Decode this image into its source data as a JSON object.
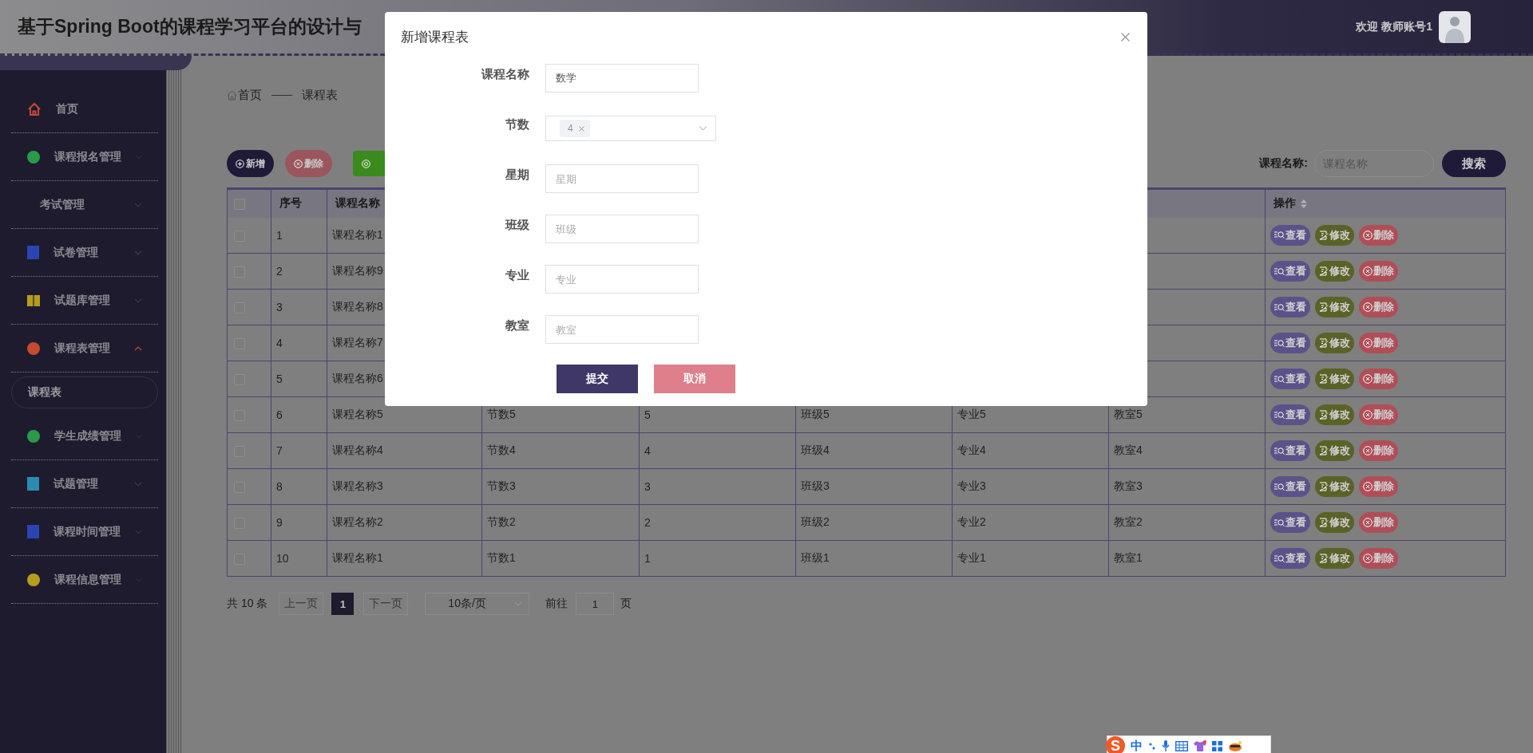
{
  "header": {
    "title": "基于Spring Boot的课程学习平台的设计与",
    "welcome": "欢迎 教师账号1"
  },
  "sidebar": {
    "items": [
      {
        "label": "首页",
        "color": "#c44a30"
      },
      {
        "label": "课程报名管理",
        "color": "#2a9a4a",
        "expanded": false
      },
      {
        "label": "考试管理",
        "expanded": false
      },
      {
        "label": "试卷管理",
        "color": "#2a44b4",
        "expanded": false
      },
      {
        "label": "试题库管理",
        "color": "#b89c1c",
        "expanded": false
      },
      {
        "label": "课程表管理",
        "color": "#c44a30",
        "expanded": true,
        "children": [
          {
            "label": "课程表",
            "selected": true
          }
        ]
      },
      {
        "label": "学生成绩管理",
        "color": "#2a9a4a",
        "expanded": false
      },
      {
        "label": "试题管理",
        "color": "#2a8cb0",
        "expanded": false
      },
      {
        "label": "课程时间管理",
        "color": "#2a44b4",
        "expanded": false
      },
      {
        "label": "课程信息管理",
        "color": "#b89c1c",
        "expanded": false
      }
    ]
  },
  "breadcrumb": [
    "首页",
    "课程表"
  ],
  "toolbar": {
    "buttons": [
      {
        "kind": "add",
        "label": "新增"
      },
      {
        "kind": "delete",
        "label": "删除"
      },
      {
        "kind": "other"
      }
    ],
    "search": {
      "label": "课程名称:",
      "placeholder": "课程名称",
      "button": "搜索"
    }
  },
  "table": {
    "select_all_checked": false,
    "columns": [
      {
        "label": "序号"
      },
      {
        "label": "课程名称"
      },
      {},
      {},
      {},
      {},
      {},
      {
        "label": "操作",
        "sortable": true
      }
    ],
    "rows": [
      {
        "checked": false,
        "cells": [
          "1",
          "课程名称1"
        ],
        "actions": [
          {
            "kind": "view",
            "label": "查看"
          },
          {
            "kind": "edit",
            "label": "修改"
          },
          {
            "kind": "delete",
            "label": "删除"
          }
        ]
      },
      {
        "checked": false,
        "cells": [
          "2",
          "课程名称9"
        ],
        "actions": [
          {
            "kind": "view",
            "label": "查看"
          },
          {
            "kind": "edit",
            "label": "修改"
          },
          {
            "kind": "delete",
            "label": "删除"
          }
        ]
      },
      {
        "checked": false,
        "cells": [
          "3",
          "课程名称8"
        ],
        "actions": [
          {
            "kind": "view",
            "label": "查看"
          },
          {
            "kind": "edit",
            "label": "修改"
          },
          {
            "kind": "delete",
            "label": "删除"
          }
        ]
      },
      {
        "checked": false,
        "cells": [
          "4",
          "课程名称7"
        ],
        "actions": [
          {
            "kind": "view",
            "label": "查看"
          },
          {
            "kind": "edit",
            "label": "修改"
          },
          {
            "kind": "delete",
            "label": "删除"
          }
        ]
      },
      {
        "checked": false,
        "cells": [
          "5",
          "课程名称6"
        ],
        "actions": [
          {
            "kind": "view",
            "label": "查看"
          },
          {
            "kind": "edit",
            "label": "修改"
          },
          {
            "kind": "delete",
            "label": "删除"
          }
        ]
      },
      {
        "checked": false,
        "cells": [
          "6",
          "课程名称5",
          "节数5",
          "5",
          "班级5",
          "专业5",
          "教室5"
        ],
        "actions": [
          {
            "kind": "view",
            "label": "查看"
          },
          {
            "kind": "edit",
            "label": "修改"
          },
          {
            "kind": "delete",
            "label": "删除"
          }
        ]
      },
      {
        "checked": false,
        "cells": [
          "7",
          "课程名称4",
          "节数4",
          "4",
          "班级4",
          "专业4",
          "教室4"
        ],
        "actions": [
          {
            "kind": "view",
            "label": "查看"
          },
          {
            "kind": "edit",
            "label": "修改"
          },
          {
            "kind": "delete",
            "label": "删除"
          }
        ]
      },
      {
        "checked": false,
        "cells": [
          "8",
          "课程名称3",
          "节数3",
          "3",
          "班级3",
          "专业3",
          "教室3"
        ],
        "actions": [
          {
            "kind": "view",
            "label": "查看"
          },
          {
            "kind": "edit",
            "label": "修改"
          },
          {
            "kind": "delete",
            "label": "删除"
          }
        ]
      },
      {
        "checked": false,
        "cells": [
          "9",
          "课程名称2",
          "节数2",
          "2",
          "班级2",
          "专业2",
          "教室2"
        ],
        "actions": [
          {
            "kind": "view",
            "label": "查看"
          },
          {
            "kind": "edit",
            "label": "修改"
          },
          {
            "kind": "delete",
            "label": "删除"
          }
        ]
      },
      {
        "checked": false,
        "cells": [
          "10",
          "课程名称1",
          "节数1",
          "1",
          "班级1",
          "专业1",
          "教室1"
        ],
        "actions": [
          {
            "kind": "view",
            "label": "查看"
          },
          {
            "kind": "edit",
            "label": "修改"
          },
          {
            "kind": "delete",
            "label": "删除"
          }
        ]
      }
    ]
  },
  "pagination": {
    "total": "共 10 条",
    "prev": {
      "label": "上一页",
      "disabled": true
    },
    "pages": [
      {
        "label": "1",
        "selected": true
      }
    ],
    "next": {
      "label": "下一页",
      "disabled": true
    },
    "page_size": "10条/页",
    "goto_label": "前往",
    "goto_value": "1",
    "goto_suffix": "页"
  },
  "dialog": {
    "title": "新增课程表",
    "fields": [
      {
        "kind": "input",
        "label": "课程名称",
        "value": "数学"
      },
      {
        "kind": "select",
        "label": "节数",
        "tags": [
          "4"
        ]
      },
      {
        "kind": "input",
        "label": "星期",
        "placeholder": "星期"
      },
      {
        "kind": "input",
        "label": "班级",
        "placeholder": "班级"
      },
      {
        "kind": "input",
        "label": "专业",
        "placeholder": "专业"
      },
      {
        "kind": "input",
        "label": "教室",
        "placeholder": "教室"
      }
    ],
    "buttons": [
      {
        "kind": "submit",
        "label": "提交"
      },
      {
        "kind": "cancel",
        "label": "取消"
      }
    ]
  },
  "ime_toolbar": {
    "logo": "S",
    "mode": "中"
  }
}
